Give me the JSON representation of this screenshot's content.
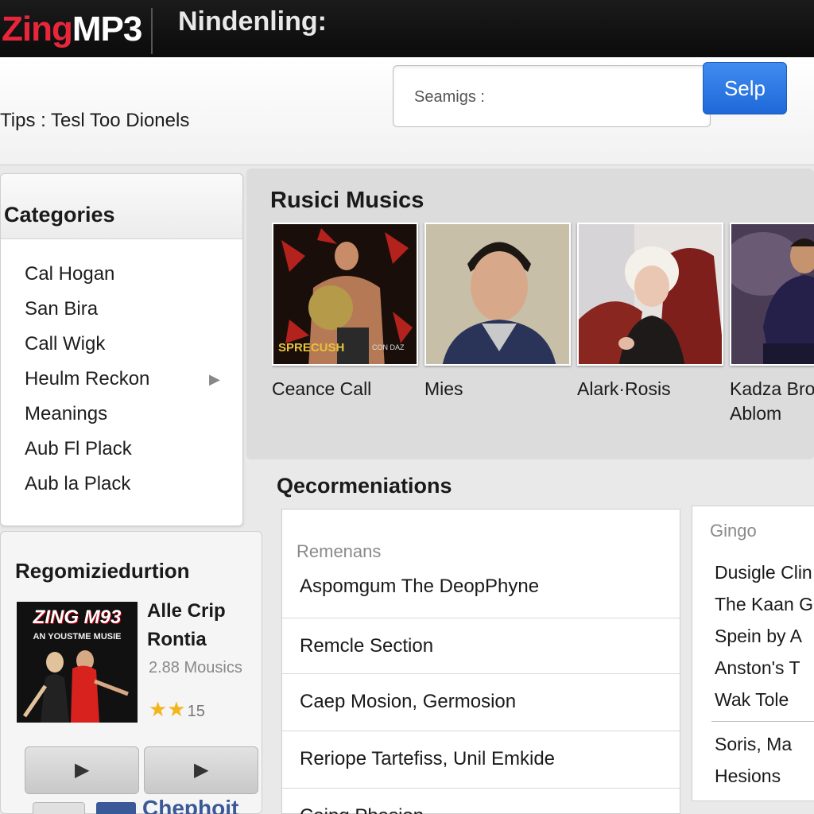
{
  "brand": {
    "logo_part1": "Zing",
    "logo_part2": "MP3",
    "accent": "#e8263a"
  },
  "topbar": {
    "title": "Nindenling:"
  },
  "header": {
    "tips": "Tips : Tesl Too Dionels",
    "search": {
      "placeholder": "Seamigs :",
      "button_label": "Selp",
      "button_color": "#2f7be6"
    }
  },
  "categories": {
    "title": "Categories",
    "items": [
      {
        "label": "Cal Hogan"
      },
      {
        "label": "San Bira"
      },
      {
        "label": "Call Wigk"
      },
      {
        "label": "Heulm Reckon",
        "has_submenu": true
      },
      {
        "label": "Meanings"
      },
      {
        "label": "Aub Fl Plack"
      },
      {
        "label": "Aub la Plack"
      }
    ]
  },
  "music": {
    "title": "Rusici Musics",
    "cards": [
      {
        "title": "Ceance Call",
        "cover_text": "SPRECUSH",
        "cover_text2": "CON DAZ"
      },
      {
        "title": "Mies"
      },
      {
        "title": "Alark·Rosis"
      },
      {
        "title": "Kadza Bro",
        "subtitle": "Ablom"
      }
    ]
  },
  "recommendations": {
    "title": "Qecormeniations",
    "subheading": "Remenans",
    "items": [
      "Aspomgum The DeopPhyne",
      "Remcle Section",
      "Caep Mosion, Germosion",
      "Reriope Tartefiss, Unil Emkide",
      "Caing Phasion"
    ]
  },
  "side_list": {
    "heading": "Gingo",
    "items": [
      "Dusigle Clin",
      "The Kaan G",
      "Spein by A",
      "Anston's T",
      "Wak Tole",
      "Soris, Ma",
      "Hesions"
    ]
  },
  "promo": {
    "title": "Regomiziedurtion",
    "album_logo": "ZING M93",
    "album_sub": "AN YOUSTME MUSIE",
    "artist": "Alle Crip",
    "album_name": "Rontia",
    "count": "2.88 Mousics",
    "stars": "★★",
    "rating": "15",
    "play_icon": "▶",
    "facebook_label": "Chephoit"
  }
}
